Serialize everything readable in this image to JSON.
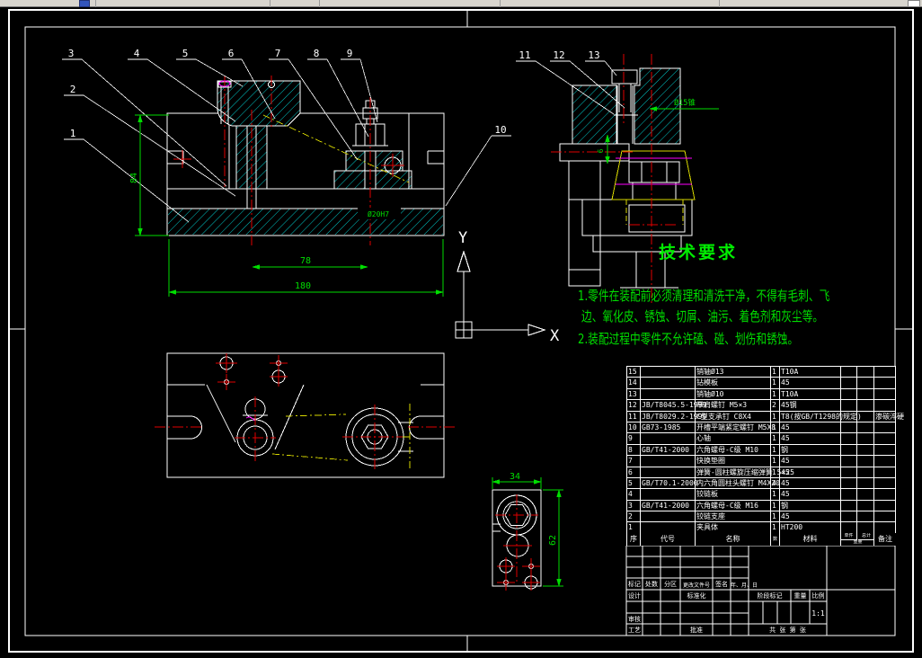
{
  "tech_requirements": {
    "title": "技术要求",
    "line1": "1.零件在装配前必须清理和清洗干净，不得有毛刺、飞",
    "line2": "边、氧化皮、锈蚀、切屑、油污、着色剂和灰尘等。",
    "line3": "2.装配过程中零件不允许磕、碰、划伤和锈蚀。"
  },
  "ucs": {
    "x_label": "X",
    "y_label": "Y"
  },
  "balloons": {
    "n1": "1",
    "n2": "2",
    "n3": "3",
    "n4": "4",
    "n5": "5",
    "n6": "6",
    "n7": "7",
    "n8": "8",
    "n9": "9",
    "n10": "10",
    "n11": "11",
    "n12": "12",
    "n13": "13"
  },
  "dims": {
    "height_84": "84",
    "width_78": "78",
    "width_180": "180",
    "bore": "Ø20H7",
    "taper": "Ø15锥",
    "side_small": "6",
    "detail_w": "34",
    "detail_h": "62"
  },
  "bom": {
    "header": {
      "no": "序号",
      "code": "代号",
      "name": "名称",
      "qty": "数量",
      "mat": "材料",
      "unit": "单件",
      "total": "总计",
      "weight": "重量",
      "remark": "备注"
    },
    "rows": [
      {
        "no": "15",
        "code": "",
        "name": "销轴Ø13",
        "qty": "1",
        "mat": "T10A",
        "unit": "",
        "total": "",
        "remark": ""
      },
      {
        "no": "14",
        "code": "",
        "name": "钻模板",
        "qty": "1",
        "mat": "45",
        "unit": "",
        "total": "",
        "remark": ""
      },
      {
        "no": "13",
        "code": "",
        "name": "销轴Ø10",
        "qty": "1",
        "mat": "T10A",
        "unit": "",
        "total": "",
        "remark": ""
      },
      {
        "no": "12",
        "code": "JB/T8045.5-1999",
        "name": "带肩螺钉 M5×3",
        "qty": "2",
        "mat": "45钢",
        "unit": "",
        "total": "",
        "remark": ""
      },
      {
        "no": "11",
        "code": "JB/T8029.2-1999",
        "name": "C型支承钉 C8X4",
        "qty": "1",
        "mat": "T8(按GB/T1298的规定)",
        "unit": "",
        "total": "",
        "remark": "渗碳淬硬"
      },
      {
        "no": "10",
        "code": "GB73-1985",
        "name": "开槽平端紧定螺钉 M5X8",
        "qty": "1",
        "mat": "45",
        "unit": "",
        "total": "",
        "remark": ""
      },
      {
        "no": "9",
        "code": "",
        "name": "心轴",
        "qty": "1",
        "mat": "45",
        "unit": "",
        "total": "",
        "remark": ""
      },
      {
        "no": "8",
        "code": "GB/T41-2000",
        "name": "六角螺母-C级 M10",
        "qty": "1",
        "mat": "钢",
        "unit": "",
        "total": "",
        "remark": ""
      },
      {
        "no": "7",
        "code": "",
        "name": "快换垫圈",
        "qty": "1",
        "mat": "45",
        "unit": "",
        "total": "",
        "remark": ""
      },
      {
        "no": "6",
        "code": "",
        "name": "弹簧-圆柱螺旋压缩弹簧 5×25",
        "qty": "1",
        "mat": "45",
        "unit": "",
        "total": "",
        "remark": ""
      },
      {
        "no": "5",
        "code": "GB/T70.1-2000",
        "name": "内六角圆柱头螺钉 M4X20",
        "qty": "4",
        "mat": "45",
        "unit": "",
        "total": "",
        "remark": ""
      },
      {
        "no": "4",
        "code": "",
        "name": "铰链板",
        "qty": "1",
        "mat": "45",
        "unit": "",
        "total": "",
        "remark": ""
      },
      {
        "no": "3",
        "code": "GB/T41-2000",
        "name": "六角螺母-C级 M16",
        "qty": "1",
        "mat": "钢",
        "unit": "",
        "total": "",
        "remark": ""
      },
      {
        "no": "2",
        "code": "",
        "name": "铰链支座",
        "qty": "1",
        "mat": "45",
        "unit": "",
        "total": "",
        "remark": ""
      },
      {
        "no": "1",
        "code": "",
        "name": "夹具体",
        "qty": "1",
        "mat": "HT200",
        "unit": "",
        "total": "",
        "remark": ""
      }
    ]
  },
  "title_block": {
    "mark": "标记",
    "count": "处数",
    "zone": "分区",
    "change_doc": "更改文件号",
    "sign": "签名",
    "date": "年、月、日",
    "design": "设计",
    "standard": "标准化",
    "check": "审核",
    "process": "工艺",
    "approve": "批准",
    "stage": "阶段标记",
    "weight": "重量",
    "scale": "比例",
    "scale_value": "1:1",
    "sheets": "共  张  第  张"
  }
}
